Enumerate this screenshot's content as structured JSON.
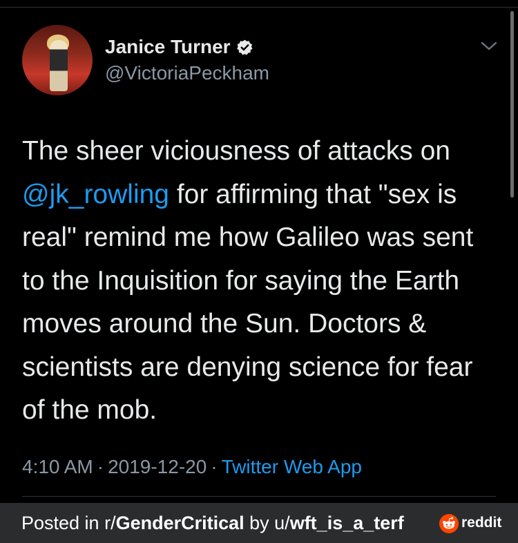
{
  "tweet": {
    "author_name": "Janice Turner",
    "handle": "@VictoriaPeckham",
    "verified_icon": "verified-badge-icon",
    "text_before": "The sheer viciousness of attacks on ",
    "mention": "@jk_rowling",
    "text_after": " for affirming that \"sex is real\" remind me how Galileo was sent to the Inquisition for saying the Earth moves around the Sun. Doctors & scientists are denying science for fear of the mob.",
    "time": "4:10 AM",
    "date": "2019-12-20",
    "separator": "·",
    "source_app": "Twitter Web App"
  },
  "banner": {
    "posted_in_prefix": "Posted in r/",
    "subreddit": "GenderCritical",
    "by_prefix": " by u/",
    "username": "wft_is_a_terf",
    "brand": "reddit"
  },
  "colors": {
    "background": "#000000",
    "link_blue": "#1d9bf0",
    "secondary_text": "#8b98a5",
    "banner_bg": "#2a2c2e",
    "reddit_orange": "#ff4500"
  }
}
